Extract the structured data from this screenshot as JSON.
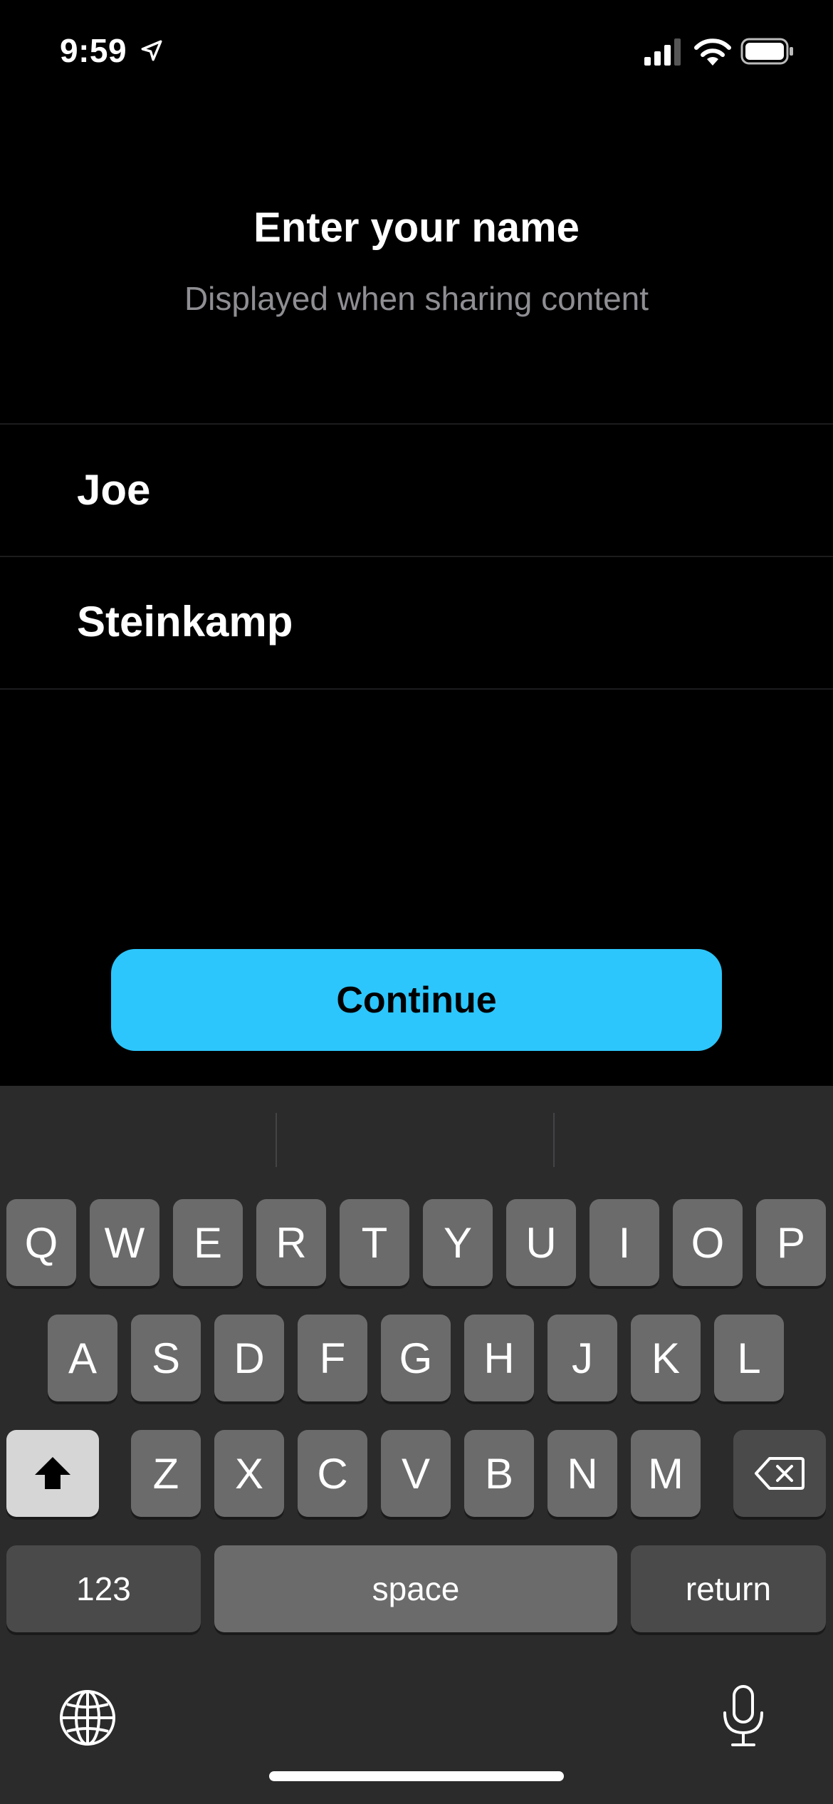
{
  "status_bar": {
    "time": "9:59",
    "icons": [
      "location-arrow-icon",
      "cellular-signal-icon",
      "wifi-icon",
      "battery-icon"
    ]
  },
  "header": {
    "title": "Enter your name",
    "subtitle": "Displayed when sharing content"
  },
  "form": {
    "first_name": "Joe",
    "last_name": "Steinkamp"
  },
  "actions": {
    "continue_label": "Continue",
    "accent_color": "#2cc6fc"
  },
  "keyboard": {
    "row1": [
      "Q",
      "W",
      "E",
      "R",
      "T",
      "Y",
      "U",
      "I",
      "O",
      "P"
    ],
    "row2": [
      "A",
      "S",
      "D",
      "F",
      "G",
      "H",
      "J",
      "K",
      "L"
    ],
    "row3": [
      "Z",
      "X",
      "C",
      "V",
      "B",
      "N",
      "M"
    ],
    "numbers_label": "123",
    "space_label": "space",
    "return_label": "return",
    "icons": [
      "shift-icon",
      "backspace-icon",
      "globe-icon",
      "microphone-icon"
    ]
  }
}
